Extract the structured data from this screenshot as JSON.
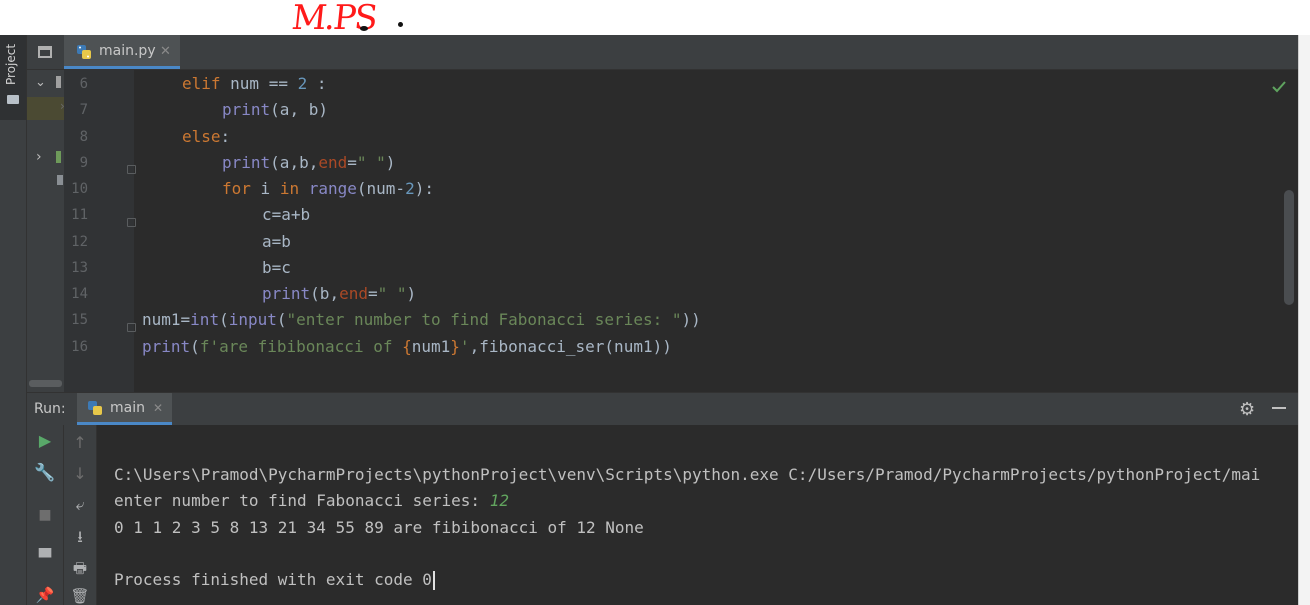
{
  "annotation": {
    "text": "M.PS"
  },
  "sidebar": {
    "project_label": "Project"
  },
  "editor": {
    "tab": {
      "filename": "main.py",
      "close": "✕"
    },
    "lines": [
      {
        "num": "6"
      },
      {
        "num": "7"
      },
      {
        "num": "8"
      },
      {
        "num": "9"
      },
      {
        "num": "10"
      },
      {
        "num": "11"
      },
      {
        "num": "12"
      },
      {
        "num": "13"
      },
      {
        "num": "14"
      },
      {
        "num": "15"
      },
      {
        "num": "16"
      }
    ],
    "tokens": {
      "l6_kw": "elif",
      "l6_mid": " num == ",
      "l6_num": "2",
      "l6_end": " :",
      "l7_fn": "print",
      "l7_rest": "(a, b)",
      "l8_kw": "else",
      "l8_colon": ":",
      "l9_fn": "print",
      "l9_a": "(a,b,",
      "l9_kw": "end",
      "l9_eq": "=",
      "l9_str": "\" \"",
      "l9_close": ")",
      "l10_for": "for",
      "l10_i": " i ",
      "l10_in": "in",
      "l10_sp": " ",
      "l10_range": "range",
      "l10_a": "(num-",
      "l10_num": "2",
      "l10_close": "):",
      "l11": "c=a+b",
      "l12": "a=b",
      "l13": "b=c",
      "l14_fn": "print",
      "l14_a": "(b,",
      "l14_kw": "end",
      "l14_eq": "=",
      "l14_str": "\" \"",
      "l14_close": ")",
      "l15_a": "num1=",
      "l15_int": "int",
      "l15_p": "(",
      "l15_input": "input",
      "l15_p2": "(",
      "l15_str": "\"enter number to find Fabonacci series: \"",
      "l15_close": "))",
      "l16_fn": "print",
      "l16_p": "(",
      "l16_f": "f'are fibibonacci of ",
      "l16_b1": "{",
      "l16_var": "num1",
      "l16_b2": "}",
      "l16_q": "'",
      "l16_rest": ",fibonacci_ser(num1))"
    }
  },
  "run": {
    "label": "Run:",
    "tab_label": "main",
    "tab_close": "✕",
    "console": {
      "command": "C:\\Users\\Pramod\\PycharmProjects\\pythonProject\\venv\\Scripts\\python.exe C:/Users/Pramod/PycharmProjects/pythonProject/mai",
      "prompt": "enter number to find Fabonacci series: ",
      "input_value": "12",
      "output": "0 1 1 2 3 5 8 13 21 34 55 89 are fibibonacci of 12 None",
      "exit": "Process finished with exit code 0"
    }
  },
  "colors": {
    "editor_bg": "#2b2b2b",
    "panel_bg": "#3c3f41",
    "keyword": "#cc7832",
    "number": "#6897bb",
    "builtin": "#8888c6",
    "string": "#6a8759",
    "kwarg": "#aa4926",
    "accent": "#4a88c7",
    "annotation": "#ff1a1a"
  }
}
